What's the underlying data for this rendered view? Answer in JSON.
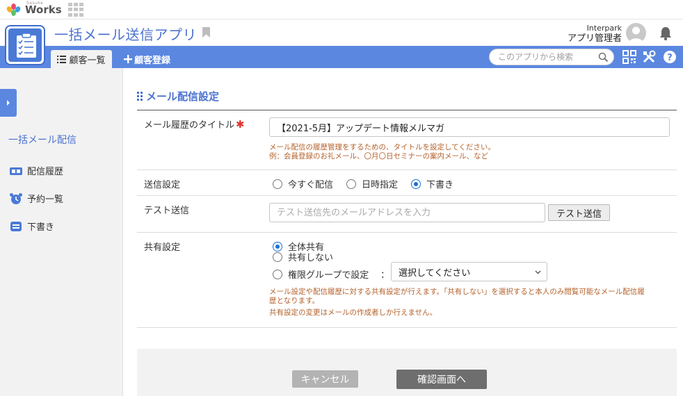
{
  "brand": {
    "sub": "Sasuke",
    "name": "Works"
  },
  "app": {
    "title": "一括メール送信アプリ"
  },
  "user": {
    "company": "Interpark",
    "role": "アプリ管理者"
  },
  "nav": {
    "tab_active": "顧客一覧",
    "tab_add": "顧客登録",
    "search_placeholder": "このアプリから検索"
  },
  "sidebar": {
    "heading": "一括メール配信",
    "items": [
      {
        "label": "配信履歴",
        "icon": "history-icon"
      },
      {
        "label": "予約一覧",
        "icon": "alarm-clock-icon"
      },
      {
        "label": "下書き",
        "icon": "draft-icon"
      }
    ]
  },
  "section": {
    "title": "メール配信設定"
  },
  "form": {
    "title_row": {
      "label": "メール履歴のタイトル",
      "required_mark": "✱",
      "value": "【2021-5月】アップデート情報メルマガ",
      "help1": "メール配信の履歴管理をするための、タイトルを設定してください。",
      "help2": "例：会員登録のお礼メール、〇月〇日セミナーの案内メール、など"
    },
    "send_row": {
      "label": "送信設定",
      "options": [
        "今すぐ配信",
        "日時指定",
        "下書き"
      ],
      "selected": "下書き"
    },
    "test_row": {
      "label": "テスト送信",
      "placeholder": "テスト送信先のメールアドレスを入力",
      "button": "テスト送信"
    },
    "share_row": {
      "label": "共有設定",
      "options": [
        "全体共有",
        "共有しない",
        "権限グループで設定"
      ],
      "selected": "全体共有",
      "colon": "：",
      "select_value": "選択してください",
      "help1": "メール設定や配信履歴に対する共有設定が行えます。「共有しない」を選択すると本人のみ閲覧可能なメール配信履",
      "help1b": "歴となります。",
      "help2": "共有設定の変更はメールの作成者しか行えません。"
    }
  },
  "buttons": {
    "cancel": "キャンセル",
    "confirm": "確認画面へ"
  },
  "colors": {
    "accent": "#5b87e0",
    "title_blue": "#4c72d0",
    "help_text": "#b4622c",
    "required": "#d33333"
  }
}
